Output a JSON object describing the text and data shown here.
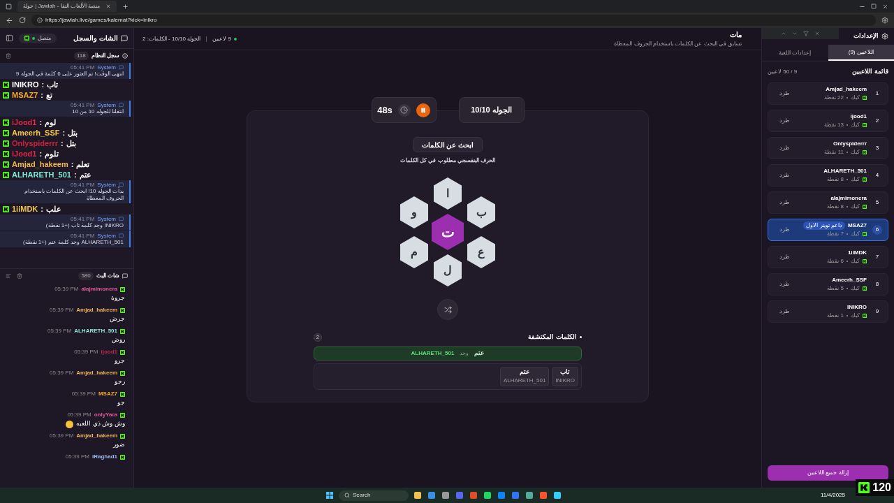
{
  "browser": {
    "tab_title": "جولة | Jawlah - منصة الألعاب التفا",
    "url": "https://jawlah.live/games/kalemat?kick=inikro"
  },
  "sidebar": {
    "title": "الشات والسجل",
    "status": "متصل",
    "connected": true,
    "log": {
      "title": "سجل النظام",
      "count": "118",
      "items": [
        {
          "kind": "system",
          "sender": "System",
          "time": "05:41 PM",
          "text": "انتهى الوقت! تم العثور على 6 كلمة في الجوله 9"
        },
        {
          "kind": "stream",
          "user": "INIKRO",
          "separator": ":",
          "word": "تاب",
          "color": "#ffffff"
        },
        {
          "kind": "stream",
          "user": "MSAZ7",
          "separator": ":",
          "word": "تع",
          "color": "#f5a623"
        },
        {
          "kind": "system",
          "sender": "System",
          "time": "05:41 PM",
          "text": "انتقلنا للجوله 10 من 10"
        },
        {
          "kind": "stream",
          "user": "iJood1",
          "separator": ":",
          "word": "لوم",
          "color": "#e0284a"
        },
        {
          "kind": "stream",
          "user": "Ameerh_SSF",
          "separator": ":",
          "word": "بتل",
          "color": "#f4c542"
        },
        {
          "kind": "stream",
          "user": "Onlyspiderrr",
          "separator": ":",
          "word": "بتل",
          "color": "#d1203c"
        },
        {
          "kind": "stream",
          "user": "iJood1",
          "separator": ":",
          "word": "تلوم",
          "color": "#e0284a"
        },
        {
          "kind": "stream",
          "user": "Amjad_hakeem",
          "separator": ":",
          "word": "تعلم",
          "color": "#f2b84b"
        },
        {
          "kind": "stream",
          "user": "ALHARETH_501",
          "separator": ":",
          "word": "عتم",
          "color": "#7fe8d8"
        },
        {
          "kind": "system",
          "sender": "System",
          "time": "05:41 PM",
          "text": "بدأت الجوله 10! ابحث عن الكلمات باستخدام الحروف المعطاة"
        },
        {
          "kind": "stream",
          "user": "1iiMDK",
          "separator": ":",
          "word": "علب",
          "color": "#f4c542"
        },
        {
          "kind": "system",
          "sender": "System",
          "time": "05:41 PM",
          "text": "INIKRO وجد كلمة تاب (+1 نقطة)"
        },
        {
          "kind": "system",
          "sender": "System",
          "time": "05:41 PM",
          "text": "ALHARETH_501 وجد كلمة عتم (+1 نقطة)"
        }
      ]
    },
    "chat": {
      "title": "شات البث",
      "count": "580",
      "messages": [
        {
          "user": "alajmimonera",
          "color": "#e05a9a",
          "time": "05:39 PM",
          "text": "جروة"
        },
        {
          "user": "Amjad_hakeem",
          "color": "#f0b35a",
          "time": "05:39 PM",
          "text": "جرض"
        },
        {
          "user": "ALHARETH_501",
          "color": "#8fe3d9",
          "time": "05:39 PM",
          "text": "روض"
        },
        {
          "user": "ijood1",
          "color": "#c0284a",
          "time": "05:39 PM",
          "text": "جرو"
        },
        {
          "user": "Amjad_hakeem",
          "color": "#f0b35a",
          "time": "05:39 PM",
          "text": "رجو"
        },
        {
          "user": "MSAZ7",
          "color": "#f5a623",
          "time": "05:39 PM",
          "text": "جو"
        },
        {
          "user": "onlyYara",
          "color": "#e05a9a",
          "time": "05:39 PM",
          "text": "وش وش ذي اللعبه",
          "emoji": true
        },
        {
          "user": "Amjad_hakeem",
          "color": "#f0b35a",
          "time": "05:39 PM",
          "text": "ضور"
        },
        {
          "user": "iRaghad1",
          "color": "#9ab8f0",
          "time": "05:39 PM"
        }
      ]
    }
  },
  "header": {
    "title": "مات",
    "subtitle": "تسابق في البحث عن الكلمات باستخدام الحروف المعطاة",
    "players": "9 لاعبين",
    "round_info": "الجوله 10/10 - الكلمات: 2"
  },
  "game": {
    "timer": "48s",
    "round": "الجوله 10/10",
    "mode": "ابحث عن الكلمات",
    "hint": "الحرف البنفسجي مطلوب في كل الكلمات",
    "center_letter": "ت",
    "letters": [
      "ا",
      "ب",
      "ع",
      "ل",
      "م",
      "و"
    ],
    "found_title": "الكلمات المكتشفة",
    "found_count": "2",
    "latest": {
      "player": "ALHARETH_501",
      "verb": "وجد",
      "word": "عتم"
    },
    "words": [
      {
        "word": "تاب",
        "player": "INIKRO"
      },
      {
        "word": "عتم",
        "player": "ALHARETH_501"
      }
    ]
  },
  "settings": {
    "title": "الإعدادات",
    "tabs": [
      {
        "label": "اللاعبين (9)",
        "selected": true
      },
      {
        "label": "إعدادات اللعبة",
        "selected": false
      }
    ],
    "list_title": "قائمة اللاعبين",
    "capacity": "9 / 50 لاعبين",
    "clear_button": "إزالة جميع اللاعبين",
    "players": [
      {
        "rank": "1",
        "name": "Amjad_hakeem",
        "platform": "كيك",
        "points": "22 نقطة",
        "action": "طرد",
        "highlighted": false
      },
      {
        "rank": "2",
        "name": "ijood1",
        "platform": "كيك",
        "points": "13 نقطة",
        "action": "طرد",
        "highlighted": false
      },
      {
        "rank": "3",
        "name": "Onlyspiderrr",
        "platform": "كيك",
        "points": "11 نقطة",
        "action": "طرد",
        "highlighted": false
      },
      {
        "rank": "4",
        "name": "ALHARETH_501",
        "platform": "كيك",
        "points": "8 نقطة",
        "action": "طرد",
        "highlighted": false
      },
      {
        "rank": "5",
        "name": "alajmimonera",
        "platform": "كيك",
        "points": "8 نقطة",
        "action": "طرد",
        "highlighted": false
      },
      {
        "rank": "6",
        "name": "MSAZ7",
        "platform": "كيك",
        "points": "7 نقطة",
        "action": "طرد",
        "highlighted": true,
        "badge": "داعم تويتر الاول"
      },
      {
        "rank": "7",
        "name": "1iiMDK",
        "platform": "كيك",
        "points": "6 نقطة",
        "action": "طرد",
        "highlighted": false
      },
      {
        "rank": "8",
        "name": "Ameerh_SSF",
        "platform": "كيك",
        "points": "5 نقطة",
        "action": "طرد",
        "highlighted": false
      },
      {
        "rank": "9",
        "name": "INIKRO",
        "platform": "كيك",
        "points": "1 نقطة",
        "action": "طرد",
        "highlighted": false
      }
    ]
  },
  "taskbar": {
    "search": "Search",
    "date": "11/4/2025"
  },
  "overlay": {
    "count": "120"
  }
}
